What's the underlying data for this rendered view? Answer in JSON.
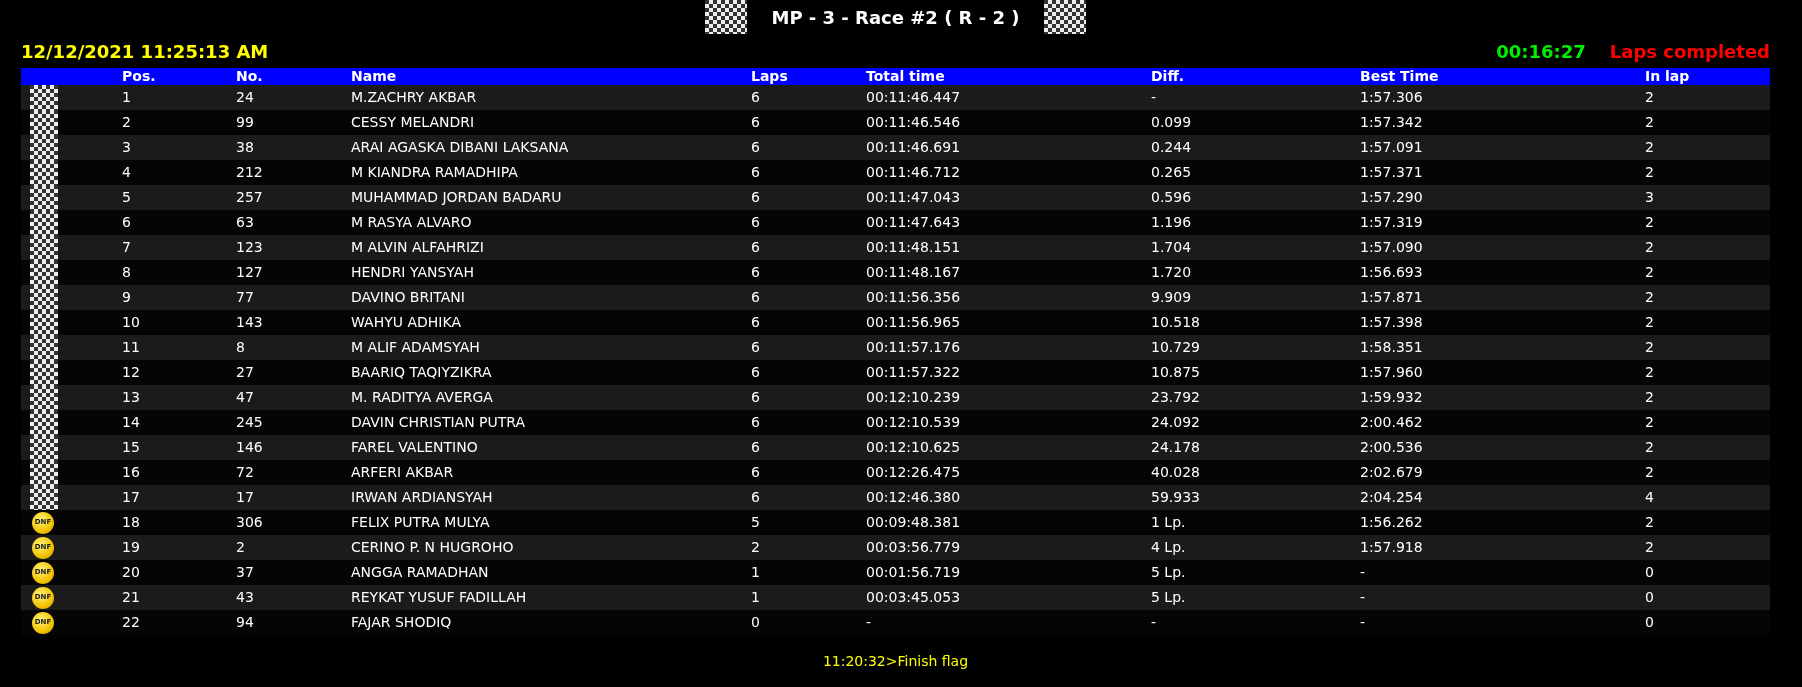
{
  "title": "MP - 3 - Race #2 ( R - 2 )",
  "datetime": "12/12/2021 11:25:13 AM",
  "clock": "00:16:27",
  "status": "Laps completed",
  "table": {
    "columns": [
      "Pos.",
      "No.",
      "Name",
      "Laps",
      "Total time",
      "Diff.",
      "Best Time",
      "In lap"
    ],
    "rows": [
      {
        "flag": {
          "kind": "checkered"
        },
        "cells": [
          "1",
          "24",
          "M.ZACHRY AKBAR",
          "6",
          "00:11:46.447",
          "-",
          "1:57.306",
          "2"
        ]
      },
      {
        "flag": {
          "kind": "checkered"
        },
        "cells": [
          "2",
          "99",
          "CESSY MELANDRI",
          "6",
          "00:11:46.546",
          "0.099",
          "1:57.342",
          "2"
        ]
      },
      {
        "flag": {
          "kind": "checkered"
        },
        "cells": [
          "3",
          "38",
          "ARAI AGASKA DIBANI LAKSANA",
          "6",
          "00:11:46.691",
          "0.244",
          "1:57.091",
          "2"
        ]
      },
      {
        "flag": {
          "kind": "checkered"
        },
        "cells": [
          "4",
          "212",
          "M KIANDRA RAMADHIPA",
          "6",
          "00:11:46.712",
          "0.265",
          "1:57.371",
          "2"
        ]
      },
      {
        "flag": {
          "kind": "checkered"
        },
        "cells": [
          "5",
          "257",
          "MUHAMMAD JORDAN BADARU",
          "6",
          "00:11:47.043",
          "0.596",
          "1:57.290",
          "3"
        ]
      },
      {
        "flag": {
          "kind": "checkered"
        },
        "cells": [
          "6",
          "63",
          "M RASYA ALVARO",
          "6",
          "00:11:47.643",
          "1.196",
          "1:57.319",
          "2"
        ]
      },
      {
        "flag": {
          "kind": "checkered"
        },
        "cells": [
          "7",
          "123",
          "M ALVIN ALFAHRIZI",
          "6",
          "00:11:48.151",
          "1.704",
          "1:57.090",
          "2"
        ]
      },
      {
        "flag": {
          "kind": "checkered"
        },
        "cells": [
          "8",
          "127",
          "HENDRI YANSYAH",
          "6",
          "00:11:48.167",
          "1.720",
          "1:56.693",
          "2"
        ]
      },
      {
        "flag": {
          "kind": "checkered"
        },
        "cells": [
          "9",
          "77",
          "DAVINO BRITANI",
          "6",
          "00:11:56.356",
          "9.909",
          "1:57.871",
          "2"
        ]
      },
      {
        "flag": {
          "kind": "checkered"
        },
        "cells": [
          "10",
          "143",
          "WAHYU ADHIKA",
          "6",
          "00:11:56.965",
          "10.518",
          "1:57.398",
          "2"
        ]
      },
      {
        "flag": {
          "kind": "checkered"
        },
        "cells": [
          "11",
          "8",
          "M ALIF ADAMSYAH",
          "6",
          "00:11:57.176",
          "10.729",
          "1:58.351",
          "2"
        ]
      },
      {
        "flag": {
          "kind": "checkered"
        },
        "cells": [
          "12",
          "27",
          "BAARIQ TAQIYZIKRA",
          "6",
          "00:11:57.322",
          "10.875",
          "1:57.960",
          "2"
        ]
      },
      {
        "flag": {
          "kind": "checkered"
        },
        "cells": [
          "13",
          "47",
          "M. RADITYA AVERGA",
          "6",
          "00:12:10.239",
          "23.792",
          "1:59.932",
          "2"
        ]
      },
      {
        "flag": {
          "kind": "checkered"
        },
        "cells": [
          "14",
          "245",
          "DAVIN CHRISTIAN PUTRA",
          "6",
          "00:12:10.539",
          "24.092",
          "2:00.462",
          "2"
        ]
      },
      {
        "flag": {
          "kind": "checkered"
        },
        "cells": [
          "15",
          "146",
          "FAREL VALENTINO",
          "6",
          "00:12:10.625",
          "24.178",
          "2:00.536",
          "2"
        ]
      },
      {
        "flag": {
          "kind": "checkered"
        },
        "cells": [
          "16",
          "72",
          "ARFERI AKBAR",
          "6",
          "00:12:26.475",
          "40.028",
          "2:02.679",
          "2"
        ]
      },
      {
        "flag": {
          "kind": "checkered"
        },
        "cells": [
          "17",
          "17",
          "IRWAN ARDIANSYAH",
          "6",
          "00:12:46.380",
          "59.933",
          "2:04.254",
          "4"
        ]
      },
      {
        "flag": {
          "kind": "dnf",
          "label": "DNF"
        },
        "cells": [
          "18",
          "306",
          "FELIX PUTRA MULYA",
          "5",
          "00:09:48.381",
          "1 Lp.",
          "1:56.262",
          "2"
        ]
      },
      {
        "flag": {
          "kind": "dnf",
          "label": "DNF"
        },
        "cells": [
          "19",
          "2",
          "CERINO P. N HUGROHO",
          "2",
          "00:03:56.779",
          "4 Lp.",
          "1:57.918",
          "2"
        ]
      },
      {
        "flag": {
          "kind": "dnf",
          "label": "DNF"
        },
        "cells": [
          "20",
          "37",
          "ANGGA RAMADHAN",
          "1",
          "00:01:56.719",
          "5 Lp.",
          "-",
          "0"
        ]
      },
      {
        "flag": {
          "kind": "dnf",
          "label": "DNF"
        },
        "cells": [
          "21",
          "43",
          "REYKAT YUSUF FADILLAH",
          "1",
          "00:03:45.053",
          "5 Lp.",
          "-",
          "0"
        ]
      },
      {
        "flag": {
          "kind": "dnf",
          "label": "DNF"
        },
        "cells": [
          "22",
          "94",
          "FAJAR SHODIQ",
          "0",
          "-",
          "-",
          "-",
          "0"
        ]
      }
    ]
  },
  "footer": "11:20:32>Finish flag"
}
